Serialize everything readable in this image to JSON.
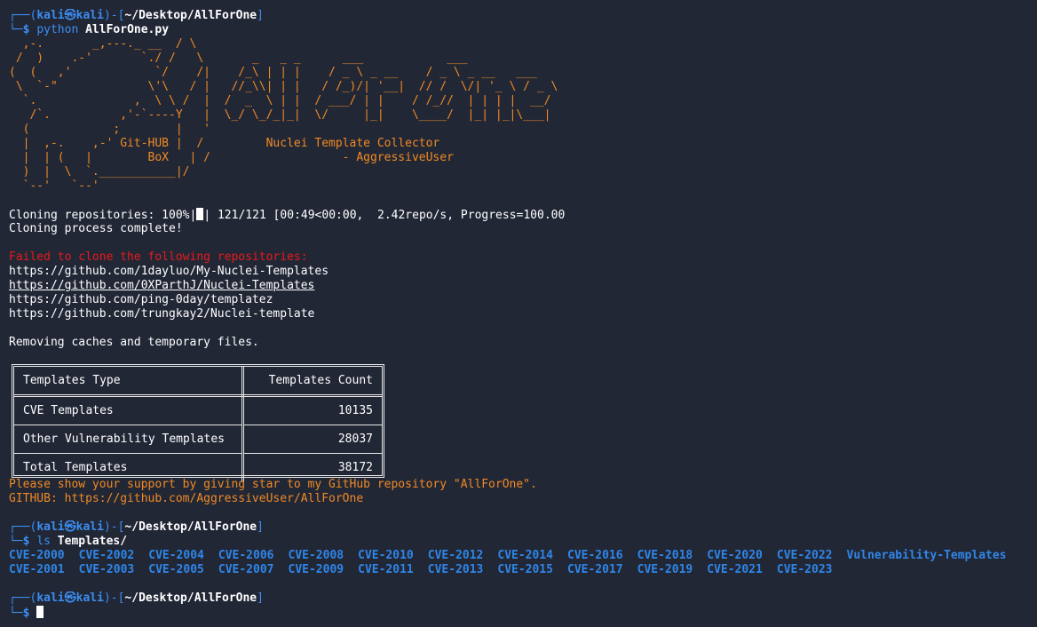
{
  "prompt1": {
    "corner_top": "┌──(",
    "user": "kali㉿kali",
    "sep": ")-[",
    "path": "~/Desktop/AllForOne",
    "close": "]",
    "corner_bottom": "└─",
    "dollar": "$ ",
    "command": "python",
    "arg": "AllForOne.py"
  },
  "banner_lines": [
    "  ,-.       _,---._ __  / \\                                          ",
    " /  )    .-'       `./ /   \\       _   _ _      ___            ___           ",
    "(  (   ,'            `/    /|    /_\\ | | |    / _ \\ _ __    / _ \\ _ __   ___ ",
    " \\  `-\"             \\'\\   / |   //_\\\\| | |   / /_)/| '__|  // /  \\/| '_ \\ / _ \\",
    "  `.              ,  \\ \\ /  |  /  _  \\ | |  / ___/ | |    / /_//  | | | |  __/",
    "   /`.          ,'-`----Y   |  \\_/ \\_/_|_|  \\/     |_|    \\____/  |_| |_|\\___|",
    "  (            ;        |   '                                                 ",
    "  |  ,-.    ,-' Git-HUB |  /         Nuclei Template Collector",
    "  |  | (   |        BoX   | /                   - AggressiveUser",
    "  )  |  \\  `.___________|/                                            ",
    "  `--'   `--'                                                          "
  ],
  "progress": {
    "label": "Cloning repositories: 100%|",
    "rest": "| 121/121 [00:49<00:00,  2.42repo/s, Progress=100.00"
  },
  "clone_complete": "Cloning process complete!",
  "failed_header": "Failed to clone the following repositories:",
  "failed_repos": [
    "https://github.com/1dayluo/My-Nuclei-Templates",
    "https://github.com/0XParthJ/Nuclei-Templates",
    "https://github.com/ping-0day/templatez",
    "https://github.com/trungkay2/Nuclei-template"
  ],
  "removing": "Removing caches and temporary files.",
  "table": {
    "headers": [
      "Templates Type",
      "Templates Count"
    ],
    "rows": [
      [
        "CVE Templates",
        "10135"
      ],
      [
        "Other Vulnerability Templates",
        "28037"
      ],
      [
        "Total Templates",
        "38172"
      ]
    ]
  },
  "support_msg": "Please show your support by giving star to my GitHub repository \"AllForOne\".",
  "github_msg": "GITHUB: https://github.com/AggressiveUser/AllForOne",
  "prompt2": {
    "dollar": "$ ",
    "command": "ls",
    "arg": "Templates/"
  },
  "dirs_row1": [
    "CVE-2000",
    "CVE-2002",
    "CVE-2004",
    "CVE-2006",
    "CVE-2008",
    "CVE-2010",
    "CVE-2012",
    "CVE-2014",
    "CVE-2016",
    "CVE-2018",
    "CVE-2020",
    "CVE-2022",
    "Vulnerability-Templates"
  ],
  "dirs_row2": [
    "CVE-2001",
    "CVE-2003",
    "CVE-2005",
    "CVE-2007",
    "CVE-2009",
    "CVE-2011",
    "CVE-2013",
    "CVE-2015",
    "CVE-2017",
    "CVE-2019",
    "CVE-2021",
    "CVE-2023"
  ],
  "prompt3": {
    "dollar": "$ "
  },
  "colors": {
    "background": "#222736",
    "prompt_blue": "#3b8ef2",
    "banner_orange": "#f08a24",
    "error_red": "#e81a1a",
    "directory_blue": "#2f86e8"
  }
}
